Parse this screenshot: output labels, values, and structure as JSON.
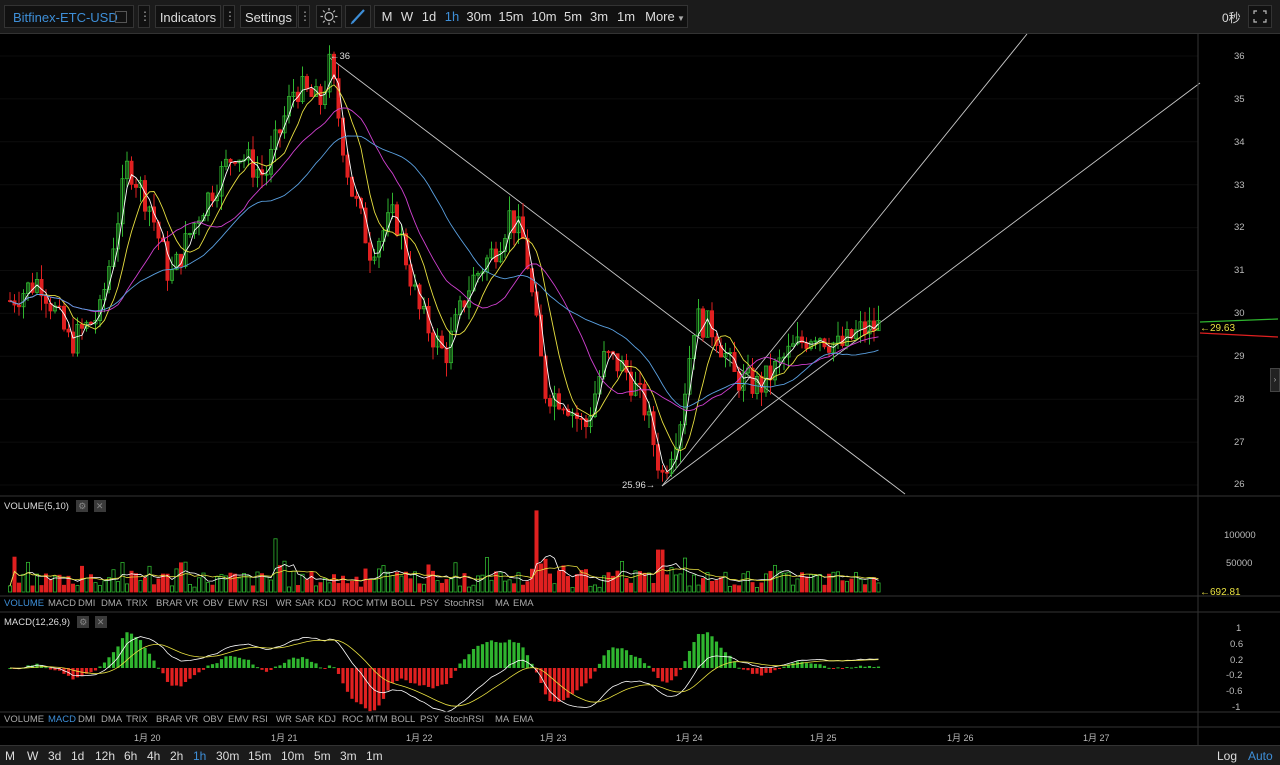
{
  "toolbar": {
    "symbol": "Bitfinex-ETC-USD",
    "indicators_label": "Indicators",
    "settings_label": "Settings",
    "intervals": [
      "M",
      "W",
      "1d",
      "1h",
      "30m",
      "15m",
      "10m",
      "5m",
      "3m",
      "1m"
    ],
    "active_interval": "1h",
    "more_label": "More",
    "countdown": "0秒"
  },
  "price_axis": {
    "ticks": [
      "36",
      "35",
      "34",
      "33",
      "32",
      "31",
      "30",
      "29",
      "28",
      "27",
      "26"
    ],
    "current_price": "29.63",
    "high_label": "36",
    "low_label": "25.96"
  },
  "volume_panel": {
    "title": "VOLUME(5,10)",
    "ticks": [
      "100000",
      "50000"
    ],
    "current": "692.81"
  },
  "macd_panel": {
    "title": "MACD(12,26,9)",
    "ticks": [
      "1",
      "0.6",
      "0.2",
      "-0.2",
      "-0.6",
      "-1"
    ]
  },
  "indicator_tabs": [
    "VOLUME",
    "MACD",
    "DMI",
    "DMA",
    "TRIX",
    "BRAR",
    "VR",
    "OBV",
    "EMV",
    "RSI",
    "WR",
    "SAR",
    "KDJ",
    "ROC",
    "MTM",
    "BOLL",
    "PSY",
    "StochRSI",
    "MA",
    "EMA"
  ],
  "indicator_tabs_row1_active": "VOLUME",
  "indicator_tabs_row2_active": "MACD",
  "time_axis": [
    "1月 20",
    "1月 21",
    "1月 22",
    "1月 23",
    "1月 24",
    "1月 25",
    "1月 26",
    "1月 27"
  ],
  "bottom_intervals": [
    "M",
    "W",
    "3d",
    "1d",
    "12h",
    "6h",
    "4h",
    "2h",
    "1h",
    "30m",
    "15m",
    "10m",
    "5m",
    "3m",
    "1m"
  ],
  "bottom_active": "1h",
  "bottom_right": [
    "Log",
    "Auto"
  ],
  "colors": {
    "up": "#2fb52f",
    "down": "#e02020",
    "ma5": "#ffffff",
    "ma10": "#e8e040",
    "ma20": "#d040d0",
    "ma30": "#5aa0e0",
    "accent": "#3e8fd8"
  }
}
